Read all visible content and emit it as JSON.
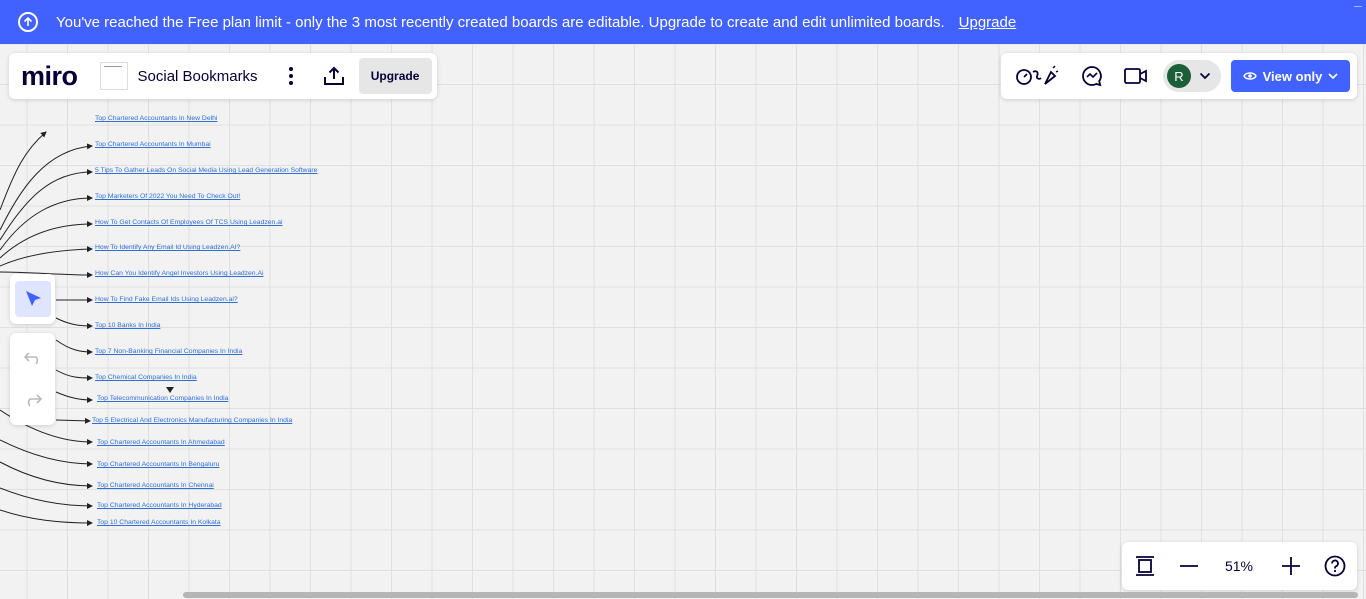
{
  "banner": {
    "message": "You've reached the Free plan limit - only the 3 most recently created boards are editable. Upgrade to create and edit unlimited boards.",
    "upgrade_link": "Upgrade"
  },
  "header": {
    "logo": "miro",
    "board_title": "Social Bookmarks",
    "upgrade_button": "Upgrade"
  },
  "collab": {
    "avatar_initial": "R",
    "view_only_label": "View only"
  },
  "zoom": {
    "level": "51%"
  },
  "links": [
    "Top Chartered Accountants In New Delhi",
    "Top Chartered Accountants In Mumbai",
    "5 Tips To Gather Leads On Social Media Using Lead Generation Software",
    "Top Marketers Of 2022 You Need To Check Out!",
    "How To Get Contacts Of Employees Of TCS Using Leadzen.ai",
    "How To Identify Any Email Id Using Leadzen.AI?",
    "How Can You Identify Angel Investors Using Leadzen.Ai",
    "How To Find Fake Email Ids Using Leadzen.ai?",
    "Top 10 Banks In India",
    "Top 7 Non-Banking Financial Companies In India",
    "Top Chemical Companies In India",
    "Top Telecommunication Companies In India",
    "Top 5 Electrical And Electronics Manufacturing Companies In India",
    "Top Chartered Accountants In Ahmedabad",
    "Top Chartered Accountants In Bengaluru",
    "Top Chartered Accountants In Chennai",
    "Top Chartered Accountants In Hyderabad",
    "Top 10 Chartered Accountants In Kolkata"
  ],
  "colors": {
    "brand_blue": "#4262ff",
    "link_blue": "#2e6fd6",
    "avatar_green": "#1b5e3a"
  }
}
